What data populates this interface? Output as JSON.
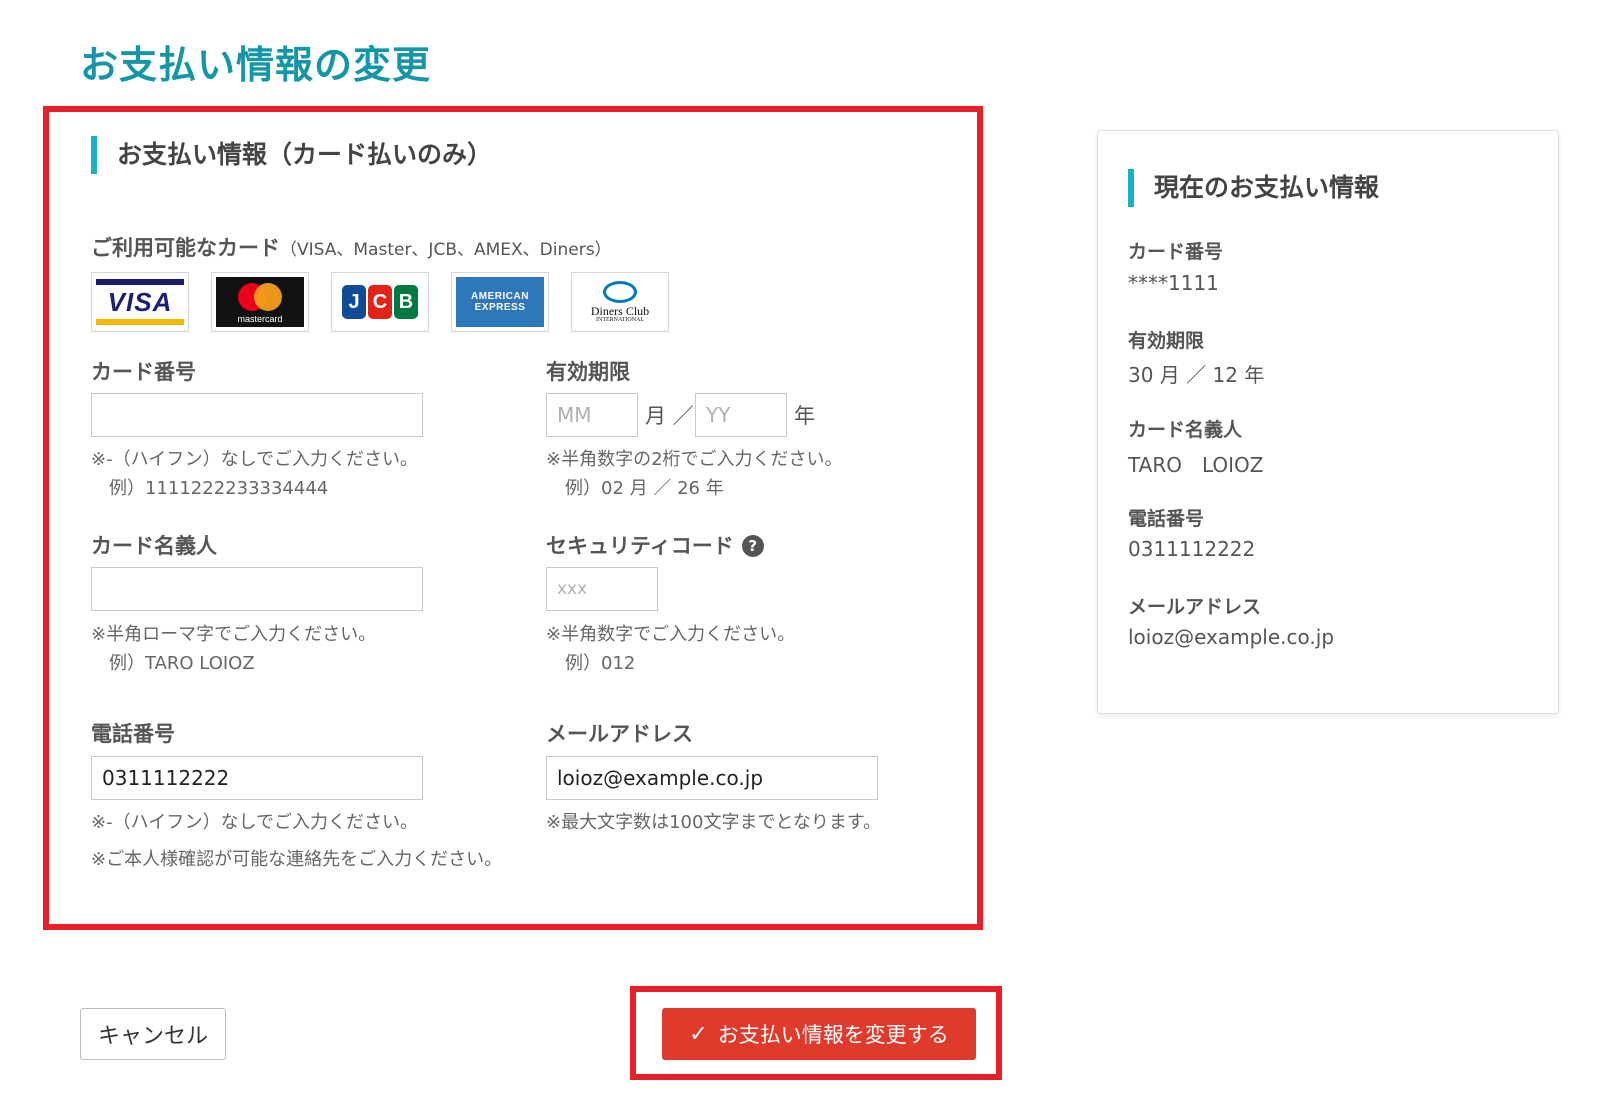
{
  "page": {
    "title": "お支払い情報の変更"
  },
  "form": {
    "section_title": "お支払い情報（カード払いのみ）",
    "cards_label": "ご利用可能なカード",
    "cards_sub": "（VISA、Master、JCB、AMEX、Diners）",
    "card_logos": [
      {
        "name": "visa-logo",
        "text": "VISA"
      },
      {
        "name": "mastercard-logo",
        "text": "mastercard"
      },
      {
        "name": "jcb-logo",
        "text": "JCB"
      },
      {
        "name": "amex-logo",
        "text_1": "AMERICAN",
        "text_2": "EXPRESS"
      },
      {
        "name": "diners-logo",
        "text_1": "Diners Club",
        "text_2": "INTERNATIONAL"
      }
    ],
    "card_number": {
      "label": "カード番号",
      "value": "",
      "placeholder": "",
      "hint_1": "※-（ハイフン）なしでご入力ください。",
      "hint_2": "例）1111222233334444"
    },
    "expiry": {
      "label": "有効期限",
      "month_placeholder": "MM",
      "month_unit": "月 ／",
      "year_placeholder": "YY",
      "year_unit": "年",
      "hint_1": "※半角数字の2桁でご入力ください。",
      "hint_2": "例）02 月 ／ 26 年"
    },
    "card_holder": {
      "label": "カード名義人",
      "value": "",
      "placeholder": "",
      "hint_1": "※半角ローマ字でご入力ください。",
      "hint_2": "例）TARO LOIOZ"
    },
    "security_code": {
      "label": "セキュリティコード",
      "help_glyph": "?",
      "placeholder": "xxx",
      "hint_1": "※半角数字でご入力ください。",
      "hint_2": "例）012"
    },
    "phone": {
      "label": "電話番号",
      "value": "0311112222",
      "hint_1": "※-（ハイフン）なしでご入力ください。",
      "hint_2": "※ご本人様確認が可能な連絡先をご入力ください。"
    },
    "email": {
      "label": "メールアドレス",
      "value": "loioz@example.co.jp",
      "hint_1": "※最大文字数は100文字までとなります。"
    }
  },
  "actions": {
    "cancel_label": "キャンセル",
    "submit_label": "お支払い情報を変更する",
    "submit_icon": "✓"
  },
  "current": {
    "title": "現在のお支払い情報",
    "items": [
      {
        "label": "カード番号",
        "value": "****1111"
      },
      {
        "label": "有効期限",
        "value": "30 月 ／ 12 年"
      },
      {
        "label": "カード名義人",
        "value": "TARO　LOIOZ"
      },
      {
        "label": "電話番号",
        "value": "0311112222"
      },
      {
        "label": "メールアドレス",
        "value": "loioz@example.co.jp"
      }
    ]
  },
  "colors": {
    "title": "#1596a7",
    "accent_bar": "#1ab0c6",
    "highlight_frame": "#e8202a",
    "submit_button": "#e03a2c"
  }
}
